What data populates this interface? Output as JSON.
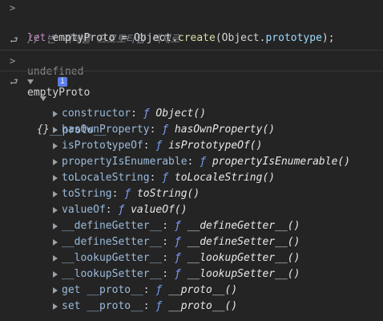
{
  "input": {
    "comment": "// 빈 객체를 프로토타입 객체로",
    "code_let": "let",
    "code_var": "emptyProto",
    "code_eq": " = ",
    "code_obj": "Object",
    "code_dot": ".",
    "code_create": "create",
    "code_open": "(",
    "code_obj2": "Object",
    "code_dot2": ".",
    "code_prototype": "prototype",
    "code_close": ");"
  },
  "result_1": "undefined",
  "input_2": "emptyProto",
  "object": {
    "label": "{}",
    "info_badge": "i",
    "proto_key": "__proto__",
    "proto_colon": ":",
    "props": [
      {
        "key": "constructor",
        "f": "ƒ",
        "sig": "Object()"
      },
      {
        "key": "hasOwnProperty",
        "f": "ƒ",
        "sig": "hasOwnProperty()"
      },
      {
        "key": "isPrototypeOf",
        "f": "ƒ",
        "sig": "isPrototypeOf()"
      },
      {
        "key": "propertyIsEnumerable",
        "f": "ƒ",
        "sig": "propertyIsEnumerable()"
      },
      {
        "key": "toLocaleString",
        "f": "ƒ",
        "sig": "toLocaleString()"
      },
      {
        "key": "toString",
        "f": "ƒ",
        "sig": "toString()"
      },
      {
        "key": "valueOf",
        "f": "ƒ",
        "sig": "valueOf()"
      },
      {
        "key": "__defineGetter__",
        "f": "ƒ",
        "sig": "__defineGetter__()"
      },
      {
        "key": "__defineSetter__",
        "f": "ƒ",
        "sig": "__defineSetter__()"
      },
      {
        "key": "__lookupGetter__",
        "f": "ƒ",
        "sig": "__lookupGetter__()"
      },
      {
        "key": "__lookupSetter__",
        "f": "ƒ",
        "sig": "__lookupSetter__()"
      },
      {
        "key": "get __proto__",
        "f": "ƒ",
        "sig": "__proto__()"
      },
      {
        "key": "set __proto__",
        "f": "ƒ",
        "sig": "__proto__()"
      }
    ]
  },
  "icons": {
    "prompt": "chevron-right-icon",
    "return": "return-arrow-icon"
  }
}
